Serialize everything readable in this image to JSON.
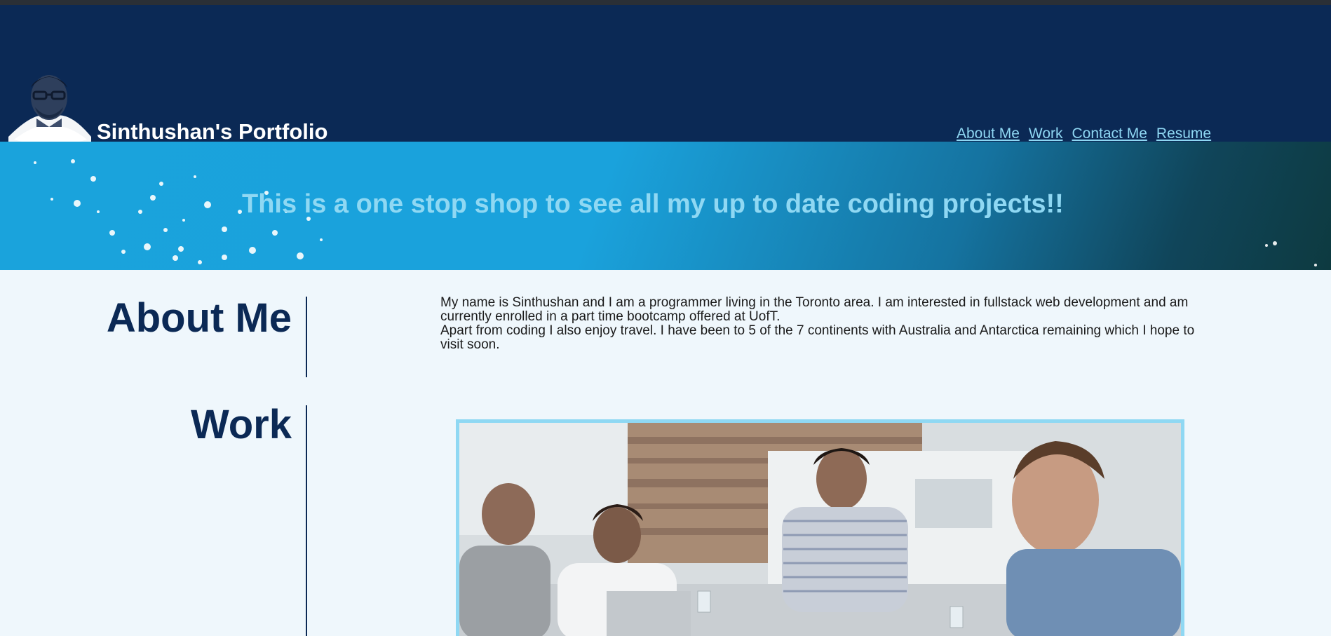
{
  "header": {
    "title": "Sinthushan's Portfolio",
    "nav": [
      {
        "label": "About Me"
      },
      {
        "label": "Work"
      },
      {
        "label": "Contact Me"
      },
      {
        "label": "Resume"
      }
    ]
  },
  "hero": {
    "tagline": "This is a one stop shop to see all my up to date coding projects!!"
  },
  "about": {
    "heading": "About Me",
    "paragraph1": "My name is Sinthushan and I am a programmer living in the Toronto area. I am interested in fullstack web development and am currently enrolled in a part time bootcamp offered at UofT.",
    "paragraph2": "Apart from coding I also enjoy travel. I have been to 5 of the 7 continents with Australia and Antarctica remaining which I hope to visit soon."
  },
  "work": {
    "heading": "Work"
  },
  "colors": {
    "header_bg": "#0b2955",
    "accent": "#8fd8f3",
    "page_bg": "#eff7fc"
  }
}
